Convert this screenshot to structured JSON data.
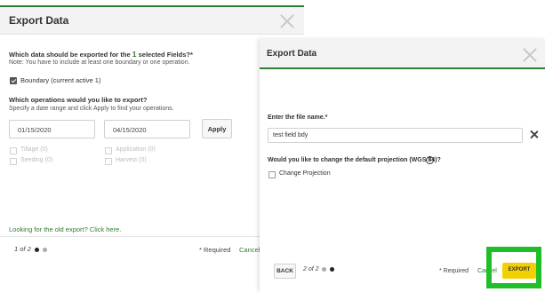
{
  "dialog1": {
    "title": "Export Data",
    "question_prefix": "Which data should be exported for the",
    "question_count": "1",
    "question_suffix": "selected Fields?*",
    "note": "Note: You have to include at least one boundary or one operation.",
    "boundary_label": "Boundary (current active 1)",
    "boundary_checked": true,
    "operations_question": "Which operations would you like to export?",
    "operations_note": "Specify a date range and click Apply to find your operations.",
    "date_from": "01/15/2020",
    "date_to": "04/15/2020",
    "apply_label": "Apply",
    "operations": [
      {
        "label": "Tillage (0)"
      },
      {
        "label": "Seeding (0)"
      },
      {
        "label": "Application (0)"
      },
      {
        "label": "Harvest (0)"
      }
    ],
    "old_export_link": "Looking for the old export? Click here.",
    "pager_text": "1 of 2",
    "required_text": "* Required",
    "cancel_label": "Cancel"
  },
  "dialog2": {
    "title": "Export Data",
    "file_name_label": "Enter the file name.*",
    "file_name_value": "test field bdy",
    "projection_question": "Would you like to change the default projection (WGS 84)?",
    "help_glyph": "?",
    "change_projection_label": "Change Projection",
    "change_projection_checked": false,
    "back_label": "BACK",
    "pager_text": "2 of 2",
    "required_text": "* Required",
    "cancel_label": "Cancel",
    "export_label": "EXPORT"
  },
  "colors": {
    "accent_green": "#2e7d32",
    "export_yellow": "#f5d000",
    "highlight_green": "#1fbf2a"
  }
}
